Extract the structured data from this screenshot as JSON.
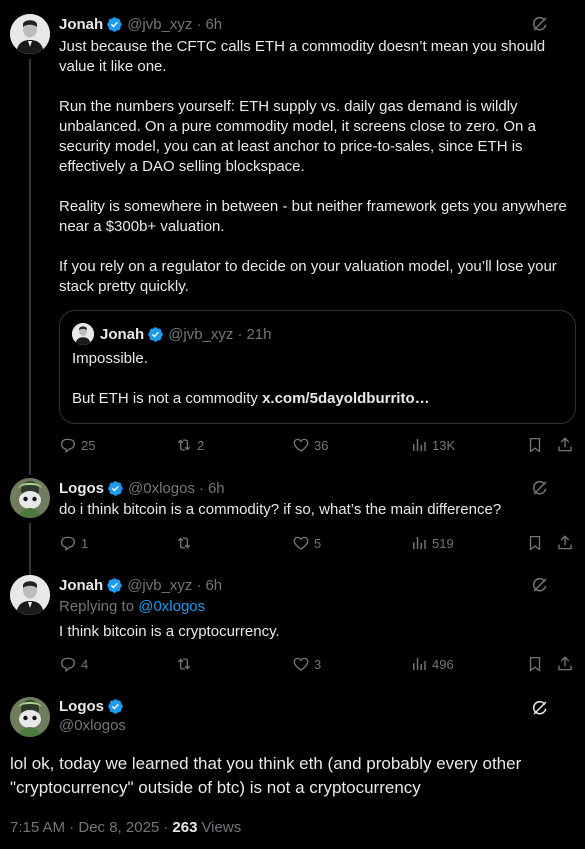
{
  "tweets": [
    {
      "name": "Jonah",
      "handle": "@jvb_xyz",
      "time": "6h",
      "text": "Just because the CFTC calls ETH a commodity doesn’t mean you should value it like one.\n\nRun the numbers yourself: ETH supply vs. daily gas demand is wildly unbalanced. On a pure commodity model, it screens close to zero. On a security model, you can at least anchor to price-to-sales, since ETH is effectively a DAO selling blockspace.\n\nReality is somewhere in between - but neither framework gets you anywhere near a $300b+ valuation.\n\nIf you rely on a regulator to decide on your valuation model, you’ll lose your stack pretty quickly.",
      "quote": {
        "name": "Jonah",
        "handle": "@jvb_xyz",
        "time": "21h",
        "text": "Impossible.\n\nBut ETH is not a commodity ",
        "link": "x.com/5dayoldburrito…"
      },
      "replies": "25",
      "reposts": "2",
      "likes": "36",
      "views": "13K"
    },
    {
      "name": "Logos",
      "handle": "@0xlogos",
      "time": "6h",
      "text": "do i think bitcoin is a commodity? if so, what’s the main difference?",
      "replies": "1",
      "reposts": "",
      "likes": "5",
      "views": "519"
    },
    {
      "name": "Jonah",
      "handle": "@jvb_xyz",
      "time": "6h",
      "replying_label": "Replying to ",
      "replying_handle": "@0xlogos",
      "text": "I think bitcoin is a cryptocurrency.",
      "replies": "4",
      "reposts": "",
      "likes": "3",
      "views": "496"
    }
  ],
  "main": {
    "name": "Logos",
    "handle": "@0xlogos",
    "text": "lol ok, today we learned that you think eth (and probably every other \"cryptocurrency\" outside of btc) is not a cryptocurrency",
    "timestamp": "7:15 AM · Dec 8, 2025 · ",
    "views_count": "263",
    "views_label": "Views"
  },
  "colors": {
    "background": "#000000",
    "text": "#e7e9ea",
    "secondary": "#71767b",
    "accent": "#1d9bf0",
    "border": "#2f3336"
  },
  "icons": [
    "verified-badge-icon",
    "grok-icon",
    "reply-icon",
    "repost-icon",
    "like-icon",
    "views-icon",
    "bookmark-icon",
    "share-icon"
  ]
}
